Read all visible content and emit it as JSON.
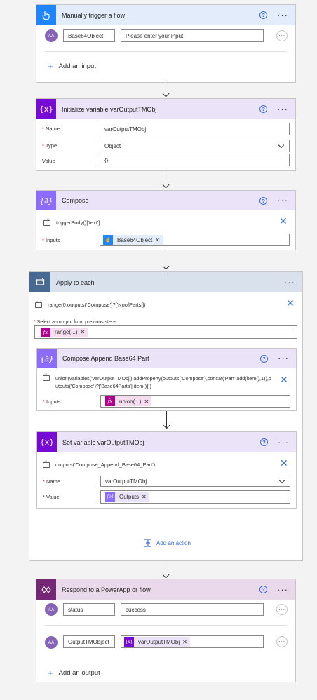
{
  "trigger": {
    "title": "Manually trigger a flow",
    "input_name": "Base64Object",
    "input_placeholder": "Please enter your input",
    "avatar_text": "AA",
    "add_input": "Add an input"
  },
  "init_var": {
    "title": "Initialize variable varOutputTMObj",
    "name_label": "Name",
    "name_value": "varOutputTMObj",
    "type_label": "Type",
    "type_value": "Object",
    "value_label": "Value",
    "value_value": "{}"
  },
  "compose": {
    "title": "Compose",
    "expr": "triggerBody()['text']",
    "inputs_label": "Inputs",
    "token": "Base64Object"
  },
  "apply": {
    "title": "Apply to each",
    "expr": "range(0,outputs('Compose')?['NoofParts'])",
    "select_label": "Select an output from previous steps",
    "token": "range(...)",
    "add_action": "Add an action"
  },
  "compose_append": {
    "title": "Compose Append Base64 Part",
    "expr_line1": "union(variables('varOutputTMObj'),addProperty(outputs('Compose'),concat('Part',add(item(),1)),o",
    "expr_line2": "utputs('Compose')?['Base64Parts'][item()]))",
    "inputs_label": "Inputs",
    "token": "union(...)"
  },
  "set_var": {
    "title": "Set variable varOutputTMObj",
    "expr": "outputs('Compose_Append_Base64_Part')",
    "name_label": "Name",
    "name_value": "varOutputTMObj",
    "value_label": "Value",
    "token": "Outputs"
  },
  "respond": {
    "title": "Respond to a PowerApp or flow",
    "row1_name": "status",
    "row1_value": "success",
    "row2_name": "OutputTMObject",
    "row2_token": "varOutputTMObj",
    "add_output": "Add an output"
  },
  "colors": {
    "trigger_header": "#e3ecfa",
    "trigger_icon": "#1f85ff",
    "variable_header": "#ebe3f7",
    "variable_icon": "#770bd6",
    "compose_icon": "#8c6cff",
    "apply_header": "#d9e1ec",
    "apply_icon": "#486991",
    "respond_header": "#ead9ea",
    "respond_icon": "#742774",
    "expr_token": "#ad008c"
  }
}
